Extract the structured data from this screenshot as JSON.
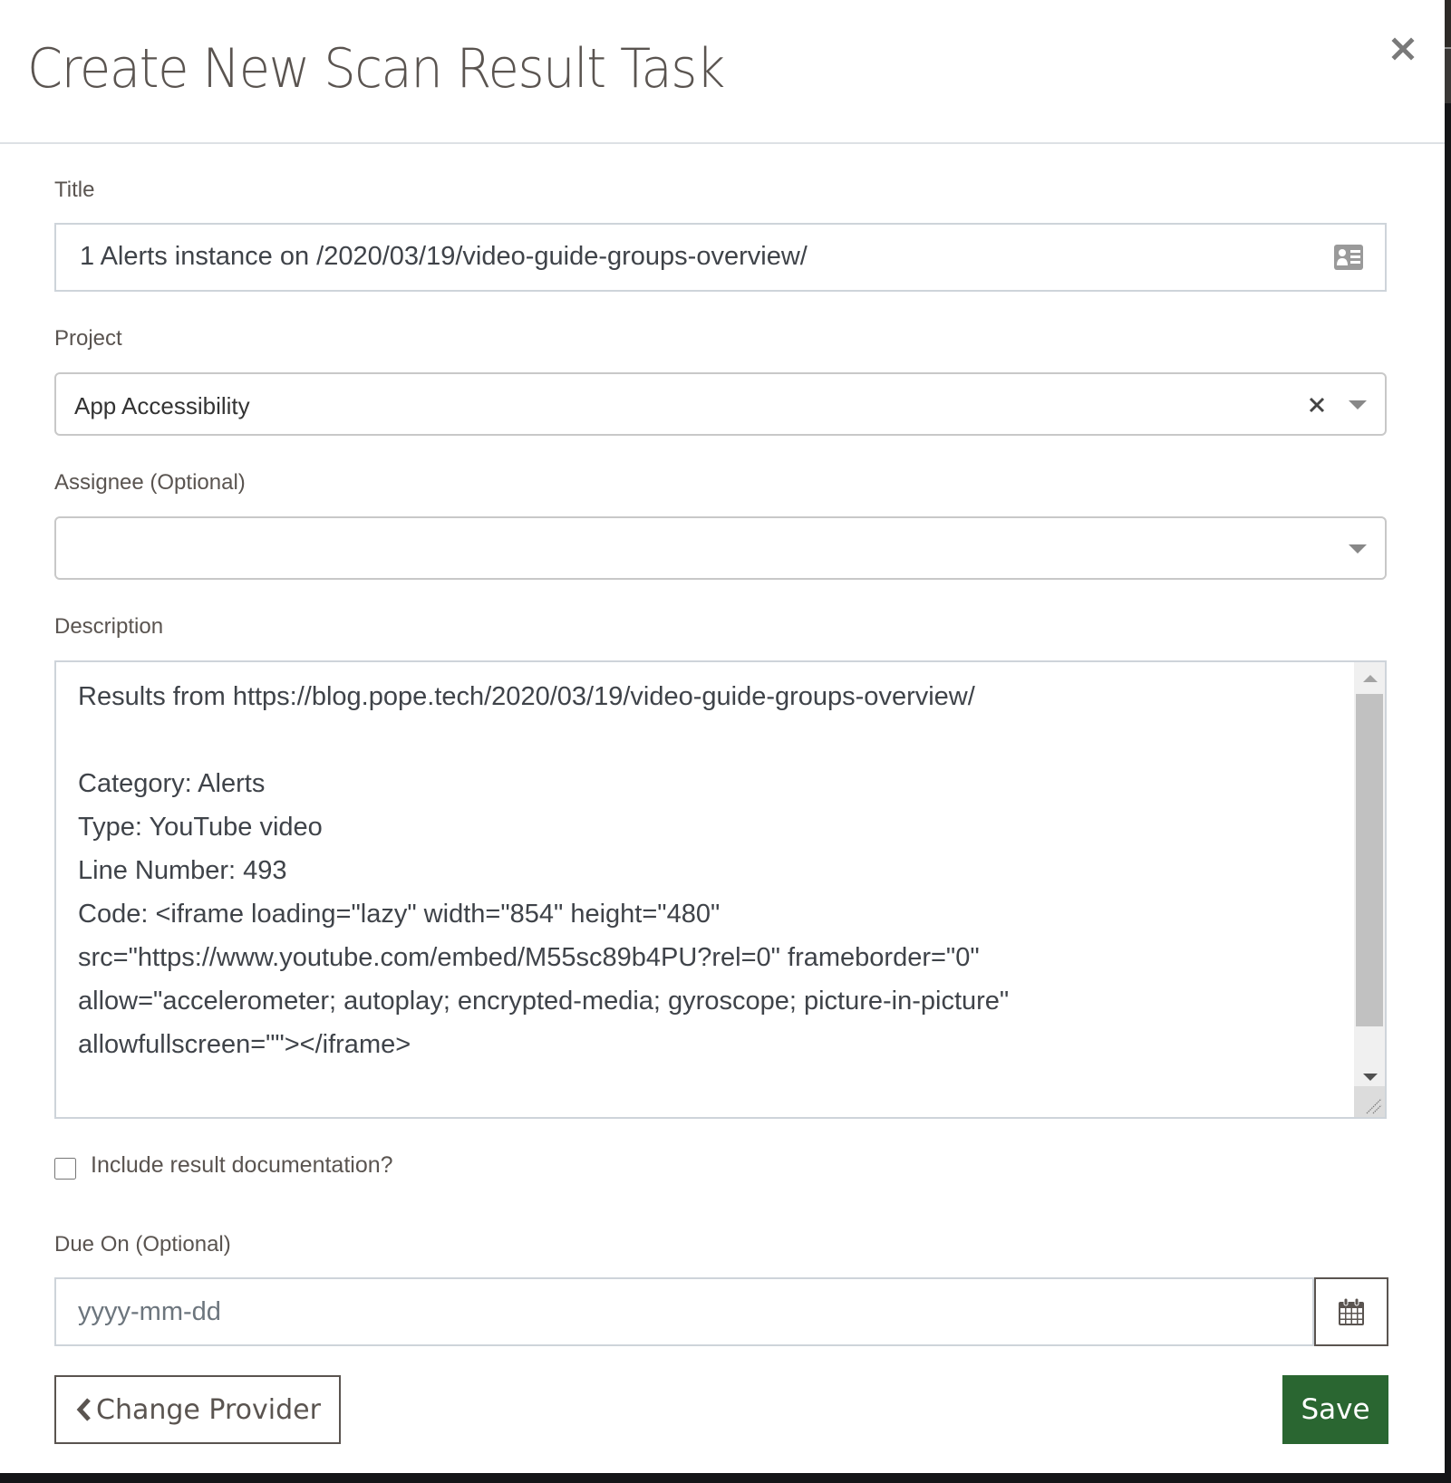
{
  "modal": {
    "title": "Create New Scan Result Task",
    "close_icon": "close-icon"
  },
  "form": {
    "title_field": {
      "label": "Title",
      "value": "1 Alerts instance on /2020/03/19/video-guide-groups-overview/",
      "icon": "id-card-icon"
    },
    "project_field": {
      "label": "Project",
      "selected": "App Accessibility",
      "clear_icon": "clear-icon",
      "arrow_icon": "caret-down-icon"
    },
    "assignee_field": {
      "label": "Assignee (Optional)",
      "selected": "",
      "arrow_icon": "caret-down-icon"
    },
    "description_field": {
      "label": "Description",
      "value": "Results from https://blog.pope.tech/2020/03/19/video-guide-groups-overview/\n\nCategory: Alerts\nType: YouTube video\nLine Number: 493\nCode: <iframe loading=\"lazy\" width=\"854\" height=\"480\"\nsrc=\"https://www.youtube.com/embed/M55sc89b4PU?rel=0\" frameborder=\"0\"\nallow=\"accelerometer; autoplay; encrypted-media; gyroscope; picture-in-picture\"\nallowfullscreen=\"\"></iframe>"
    },
    "include_documentation": {
      "label": "Include result documentation?",
      "checked": false
    },
    "due_on_field": {
      "label": "Due On (Optional)",
      "value": "",
      "placeholder": "yyyy-mm-dd",
      "icon": "calendar-icon"
    }
  },
  "footer": {
    "change_provider_label": "Change Provider",
    "change_provider_icon": "chevron-left-icon",
    "save_label": "Save"
  },
  "colors": {
    "save_button_bg": "#2a6631",
    "text_primary": "#5a5450",
    "input_border": "#ced4da"
  }
}
